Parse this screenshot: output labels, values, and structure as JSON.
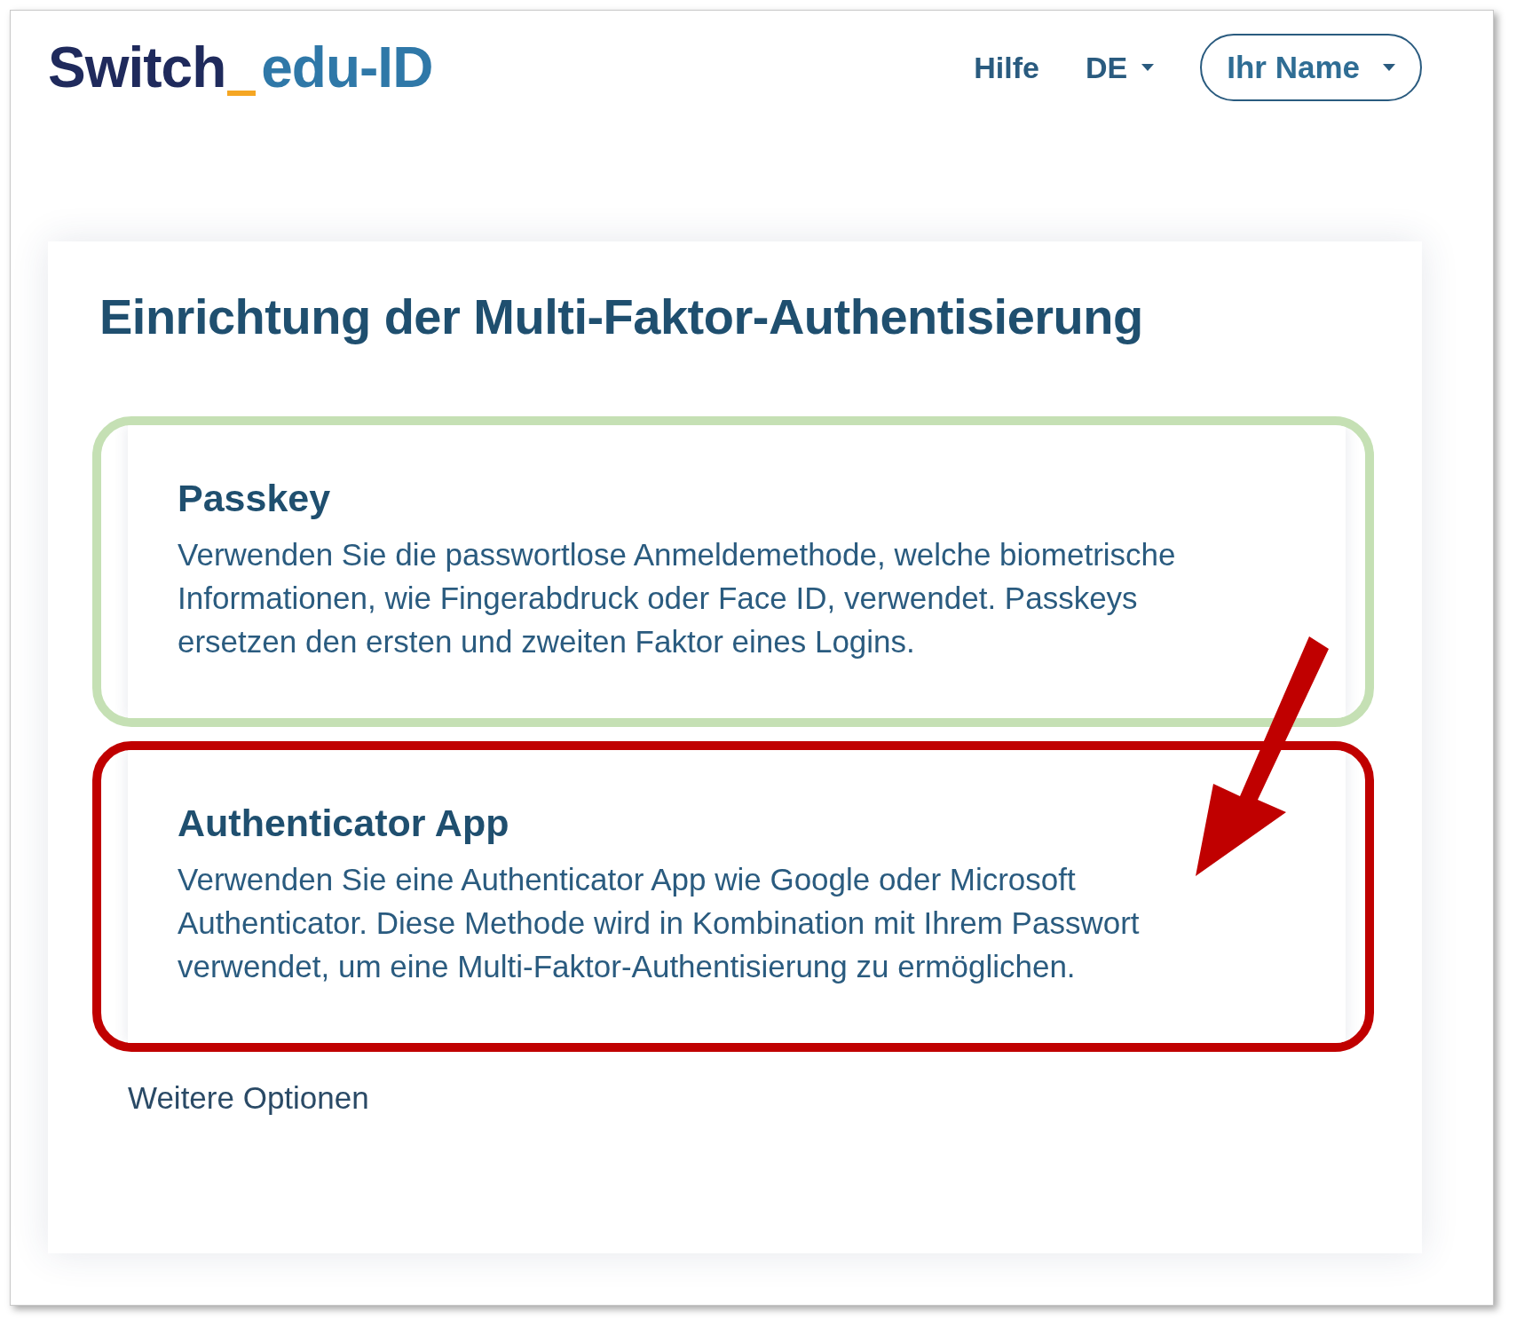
{
  "header": {
    "logo": {
      "part_1": "Switch",
      "part_2": "edu-ID"
    },
    "nav": [
      {
        "label": "Hilfe",
        "kind": "link"
      },
      {
        "label": "DE",
        "kind": "dropdown"
      }
    ],
    "user_button": {
      "label": "Ihr Name"
    }
  },
  "panel": {
    "title": "Einrichtung der Multi-Faktor-Authentisierung",
    "options": [
      {
        "title": "Passkey",
        "text": "Verwenden Sie die passwortlose Anmeldemethode, welche biometrische Informationen, wie Fingerabdruck oder Face ID, verwendet. Passkeys ersetzen den ersten und zweiten Faktor eines Logins.",
        "color": "#c5e0b4"
      },
      {
        "title": "Authenticator App",
        "text": "Verwenden Sie eine Authenticator App wie Google oder Microsoft Authenticator. Diese Methode wird in Kombination mit Ihrem Passwort verwendet, um eine Multi-Faktor-Authentisierung zu ermöglichen.",
        "color": "#c00000"
      }
    ],
    "more_link": "Weitere Optionen"
  }
}
